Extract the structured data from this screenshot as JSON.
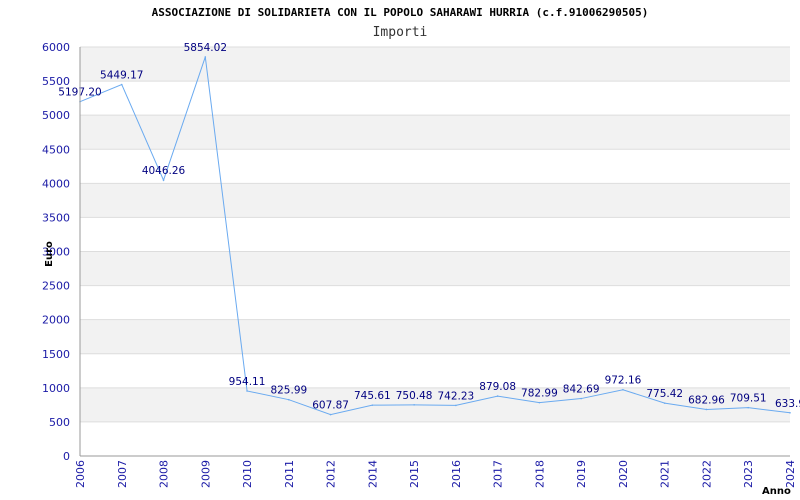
{
  "chart_data": {
    "type": "line",
    "title": "ASSOCIAZIONE DI SOLIDARIETA CON IL POPOLO SAHARAWI HURRIA (c.f.91006290505)",
    "subtitle": "Importi",
    "xlabel": "Anno",
    "ylabel": "Euro",
    "categories": [
      "2006",
      "2007",
      "2008",
      "2009",
      "2010",
      "2011",
      "2012",
      "2014",
      "2015",
      "2016",
      "2017",
      "2018",
      "2019",
      "2020",
      "2021",
      "2022",
      "2023",
      "2024"
    ],
    "series": [
      {
        "values": [
          5197.2,
          5449.17,
          4046.26,
          5854.02,
          954.11,
          825.99,
          607.87,
          745.61,
          750.48,
          742.23,
          879.08,
          782.99,
          842.69,
          972.16,
          775.42,
          682.96,
          709.51,
          633.9
        ],
        "labels": [
          "5197.20",
          "5449.17",
          "4046.26",
          "5854.02",
          "954.11",
          "825.99",
          "607.87",
          "745.61",
          "750.48",
          "742.23",
          "879.08",
          "782.99",
          "842.69",
          "972.16",
          "775.42",
          "682.96",
          "709.51",
          "633.9"
        ]
      }
    ],
    "ylim": [
      0,
      6000
    ],
    "yticks": [
      "0",
      "500",
      "1000",
      "1500",
      "2000",
      "2500",
      "3000",
      "3500",
      "4000",
      "4500",
      "5000",
      "5500",
      "6000"
    ],
    "grid": true,
    "colors": {
      "line": "#6aaaf0",
      "band": "#f2f2f2",
      "gridline": "#dddddd",
      "tick_text": "#1a1aa6",
      "label_text": "#000080"
    }
  }
}
